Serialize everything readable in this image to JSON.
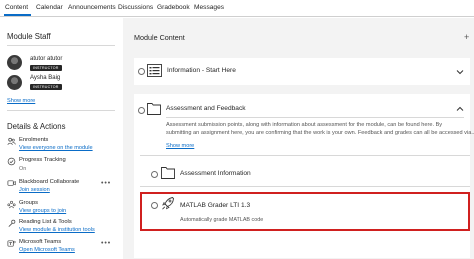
{
  "tabs": [
    {
      "label": "Content"
    },
    {
      "label": "Calendar"
    },
    {
      "label": "Announcements"
    },
    {
      "label": "Discussions"
    },
    {
      "label": "Gradebook"
    },
    {
      "label": "Messages"
    }
  ],
  "sidebar": {
    "staff_title": "Module Staff",
    "staff": [
      {
        "name": "atutor atutor",
        "role": "INSTRUCTOR"
      },
      {
        "name": "Aysha Baig",
        "role": "INSTRUCTOR"
      }
    ],
    "show_more": "Show more",
    "details_title": "Details & Actions",
    "actions": [
      {
        "title": "Enrolments",
        "link": "View everyone on the module"
      },
      {
        "title": "Progress Tracking",
        "sub": "On"
      },
      {
        "title": "Blackboard Collaborate",
        "link": "Join session"
      },
      {
        "title": "Groups",
        "link": "View groups to join"
      },
      {
        "title": "Reading List & Tools",
        "link": "View module & institution tools"
      },
      {
        "title": "Microsoft Teams",
        "link": "Open Microsoft Teams"
      }
    ]
  },
  "main": {
    "title": "Module Content",
    "items": [
      {
        "title": "Information - Start Here"
      },
      {
        "title": "Assessment and Feedback",
        "description": [
          "Assessment submission points, along with information about assessment for the module, can be found here. By",
          "submitting an assignment here, you are confirming that the work is your own. Feedback and grades can all be accessed via..."
        ],
        "show_more": "Show more",
        "children": [
          {
            "title": "Assessment Information"
          },
          {
            "title": "MATLAB Grader LTI 1.3",
            "description": "Automatically grade MATLAB code"
          }
        ]
      }
    ]
  }
}
